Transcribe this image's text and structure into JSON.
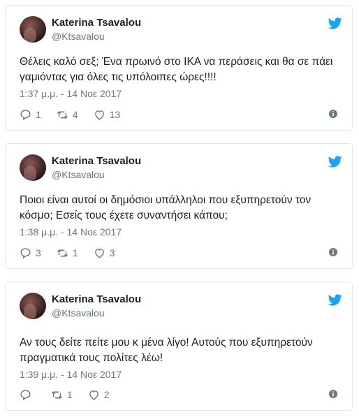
{
  "tweets": [
    {
      "author": "Katerina Tsavalou",
      "handle": "@Ktsavalou",
      "text": "Θέλεις καλό σεξ; Ένα πρωινό στο ΙΚΑ να περάσεις και θα σε πάει γαμιόντας για όλες τις υπόλοιπες ώρες!!!!",
      "timestamp": "1:37 μ.μ. - 14 Νοε 2017",
      "replies": "1",
      "retweets": "4",
      "likes": "13"
    },
    {
      "author": "Katerina Tsavalou",
      "handle": "@Ktsavalou",
      "text": "Ποιοι είναι αυτοί οι δημόσιοι υπάλληλοι που εξυπηρετούν τον κόσμο; Εσείς τους έχετε συναντήσει κάπου;",
      "timestamp": "1:38 μ.μ. - 14 Νοε 2017",
      "replies": "3",
      "retweets": "1",
      "likes": "3"
    },
    {
      "author": "Katerina Tsavalou",
      "handle": "@Ktsavalou",
      "text": "Αν τους δείτε πείτε μου κ μένα λίγο! Αυτούς που εξυπηρετούν πραγματικά τους πολίτες λέω!",
      "timestamp": "1:39 μ.μ. - 14 Νοε 2017",
      "replies": "",
      "retweets": "1",
      "likes": "2"
    }
  ],
  "colors": {
    "twitter_blue": "#1da1f2",
    "text": "#1c2022",
    "secondary": "#697882",
    "border": "#e1e8ed"
  },
  "icons": {
    "brand": "twitter-bird-icon",
    "reply": "reply-icon",
    "retweet": "retweet-icon",
    "like": "heart-icon",
    "info": "info-icon"
  }
}
